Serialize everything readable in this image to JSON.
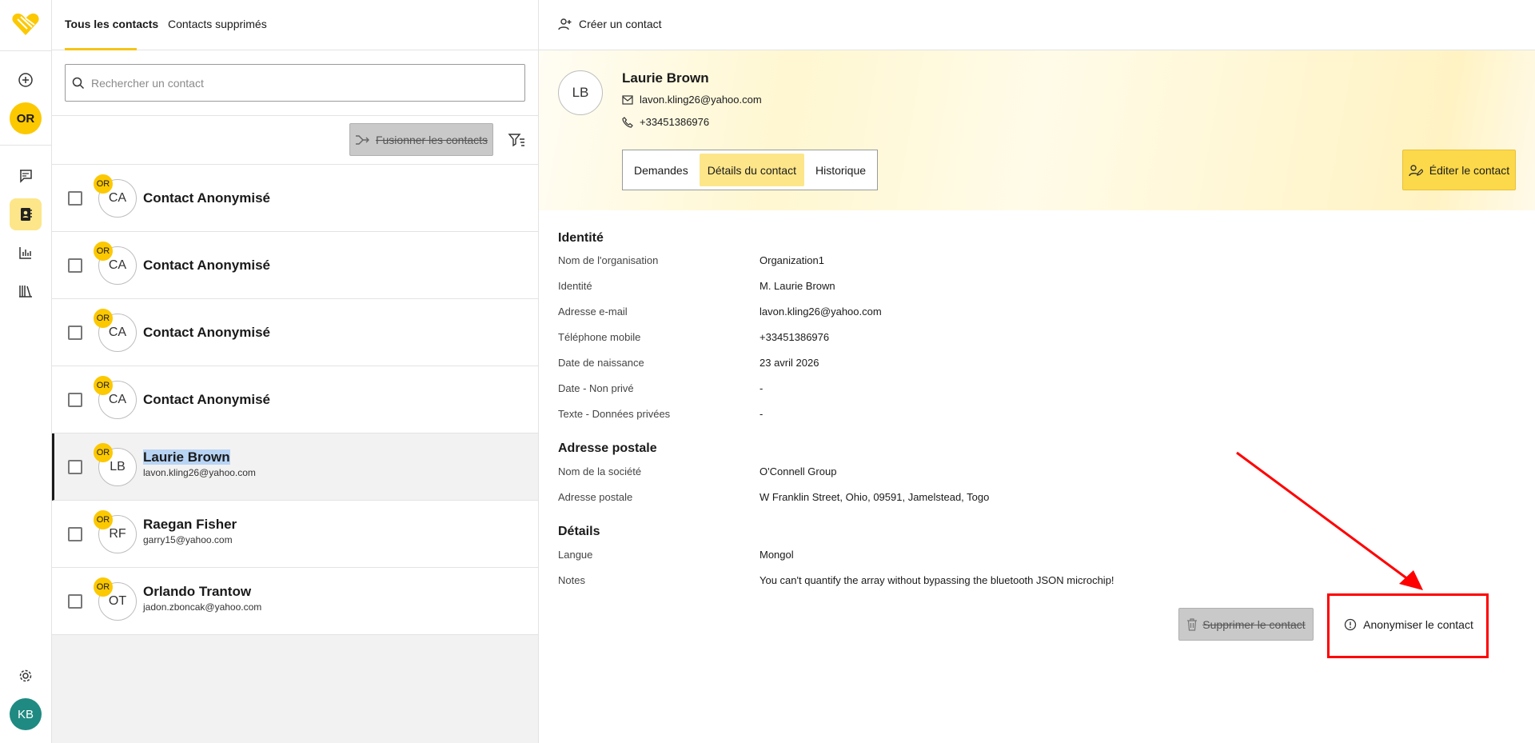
{
  "rail": {
    "org_avatar": "OR",
    "user_avatar": "KB"
  },
  "list": {
    "tabs": [
      {
        "label": "Tous les contacts"
      },
      {
        "label": "Contacts supprimés"
      }
    ],
    "search_placeholder": "Rechercher un contact",
    "merge_label": "Fusionner les contacts",
    "contacts": [
      {
        "badge": "OR",
        "initials": "CA",
        "name": "Contact Anonymisé",
        "email": ""
      },
      {
        "badge": "OR",
        "initials": "CA",
        "name": "Contact Anonymisé",
        "email": ""
      },
      {
        "badge": "OR",
        "initials": "CA",
        "name": "Contact Anonymisé",
        "email": ""
      },
      {
        "badge": "OR",
        "initials": "CA",
        "name": "Contact Anonymisé",
        "email": ""
      },
      {
        "badge": "OR",
        "initials": "LB",
        "name": "Laurie Brown",
        "email": "lavon.kling26@yahoo.com"
      },
      {
        "badge": "OR",
        "initials": "RF",
        "name": "Raegan Fisher",
        "email": "garry15@yahoo.com"
      },
      {
        "badge": "OR",
        "initials": "OT",
        "name": "Orlando Trantow",
        "email": "jadon.zboncak@yahoo.com"
      }
    ]
  },
  "detail": {
    "create_label": "Créer un contact",
    "initials": "LB",
    "name": "Laurie Brown",
    "email": "lavon.kling26@yahoo.com",
    "phone": "+33451386976",
    "tabs": [
      "Demandes",
      "Détails du contact",
      "Historique"
    ],
    "edit_label": "Éditer le contact",
    "sections": {
      "identity_title": "Identité",
      "identity": [
        {
          "label": "Nom de l'organisation",
          "value": "Organization1"
        },
        {
          "label": "Identité",
          "value": "M. Laurie Brown"
        },
        {
          "label": "Adresse e-mail",
          "value": "lavon.kling26@yahoo.com"
        },
        {
          "label": "Téléphone mobile",
          "value": "+33451386976"
        },
        {
          "label": "Date de naissance",
          "value": "23 avril 2026"
        },
        {
          "label": "Date - Non privé",
          "value": "-"
        },
        {
          "label": "Texte - Données privées",
          "value": "-"
        }
      ],
      "address_title": "Adresse postale",
      "address": [
        {
          "label": "Nom de la société",
          "value": "O'Connell Group"
        },
        {
          "label": "Adresse postale",
          "value": "W Franklin Street, Ohio, 09591, Jamelstead, Togo"
        }
      ],
      "details_title": "Détails",
      "details": [
        {
          "label": "Langue",
          "value": "Mongol"
        },
        {
          "label": "Notes",
          "value": "You can't quantify the array without bypassing the bluetooth JSON microchip!"
        }
      ]
    },
    "delete_label": "Supprimer le contact",
    "anonymize_label": "Anonymiser le contact"
  }
}
